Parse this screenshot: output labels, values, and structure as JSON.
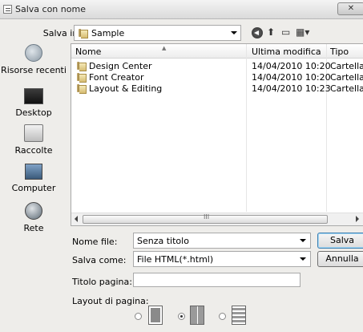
{
  "window": {
    "title": "Salva con nome",
    "close_label": "✕"
  },
  "save_in": {
    "label": "Salva in:",
    "value": "Sample"
  },
  "toolbar": {
    "up_glyph": "⬆",
    "new_folder_glyph": "▭",
    "views_glyph": "▦▾"
  },
  "places": [
    {
      "label": "Risorse recenti",
      "icon": "recent-places-icon"
    },
    {
      "label": "Desktop",
      "icon": "desktop-icon"
    },
    {
      "label": "Raccolte",
      "icon": "libraries-icon"
    },
    {
      "label": "Computer",
      "icon": "computer-icon"
    },
    {
      "label": "Rete",
      "icon": "network-icon"
    }
  ],
  "file_list": {
    "columns": [
      "Nome",
      "Ultima modifica",
      "Tipo"
    ],
    "rows": [
      {
        "name": "Design Center",
        "modified": "14/04/2010 10:20",
        "type": "Cartella d"
      },
      {
        "name": "Font Creator",
        "modified": "14/04/2010 10:20",
        "type": "Cartella d"
      },
      {
        "name": "Layout & Editing",
        "modified": "14/04/2010 10:23",
        "type": "Cartella d"
      }
    ],
    "scroll_grip": "III"
  },
  "form": {
    "filename_label": "Nome file:",
    "filename_value": "Senza titolo",
    "savetype_label": "Salva come:",
    "savetype_value": "File HTML(*.html)",
    "pagetitle_label": "Titolo pagina:",
    "pagetitle_value": "",
    "layout_label": "Layout di pagina:",
    "layout_selected": 2
  },
  "buttons": {
    "save": "Salva",
    "cancel": "Annulla"
  }
}
